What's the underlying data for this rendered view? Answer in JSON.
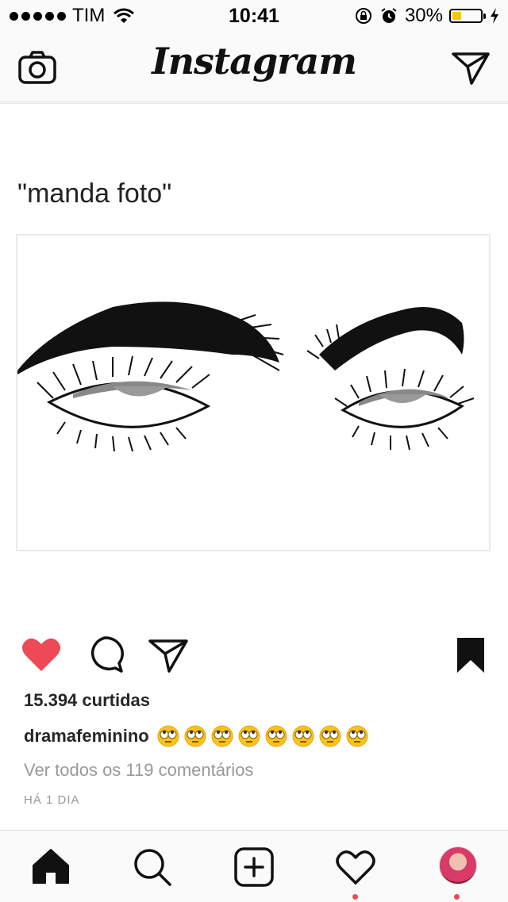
{
  "status_bar": {
    "carrier": "TIM",
    "time": "10:41",
    "battery": "30%",
    "battery_level": 0.3,
    "battery_color": "#f7c600",
    "icons": [
      "signal-dots-icon",
      "wifi-icon",
      "rotation-lock-icon",
      "alarm-icon",
      "battery-icon",
      "charging-bolt-icon"
    ]
  },
  "nav": {
    "logo": "Instagram",
    "left_icon": "camera-icon",
    "right_icon": "direct-message-icon"
  },
  "post": {
    "caption_text": "\"manda foto\"",
    "image": "eyes-illustration",
    "liked": true,
    "like_color": "#ed4956",
    "likes": "15.394 curtidas",
    "username": "dramafeminino",
    "caption_emoji": [
      "rolling-eyes-emoji",
      "rolling-eyes-emoji",
      "rolling-eyes-emoji",
      "rolling-eyes-emoji",
      "rolling-eyes-emoji",
      "rolling-eyes-emoji",
      "rolling-eyes-emoji",
      "rolling-eyes-emoji"
    ],
    "comments": "Ver todos os 119 comentários",
    "time": "HÁ 1 DIA",
    "actions": [
      "heart-icon",
      "comment-icon",
      "share-icon",
      "bookmark-icon"
    ]
  },
  "tab_bar": {
    "tabs": [
      "home-icon",
      "search-icon",
      "add-post-icon",
      "activity-icon",
      "profile-avatar"
    ],
    "notification_color": "#ed4956"
  }
}
